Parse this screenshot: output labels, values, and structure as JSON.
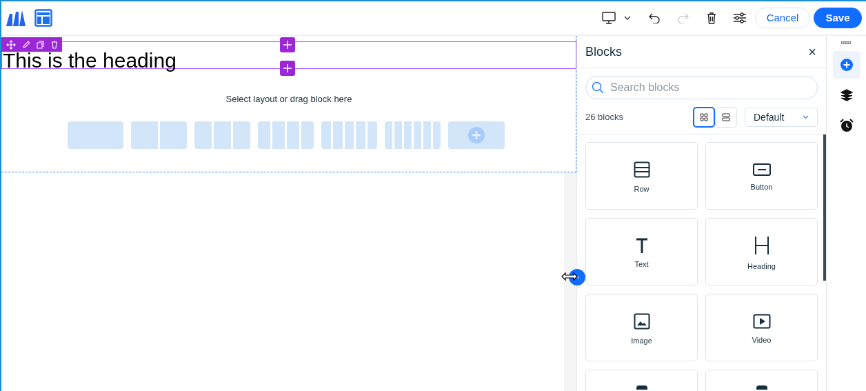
{
  "toolbar": {
    "cancel": "Cancel",
    "save": "Save",
    "redo_disabled": true
  },
  "canvas": {
    "heading": "This is the heading",
    "prompt": "Select layout or drag block here",
    "layouts": [
      {
        "kind": "cols-1"
      },
      {
        "kind": "cols-2"
      },
      {
        "kind": "cols-3"
      },
      {
        "kind": "cols-4"
      },
      {
        "kind": "cols-5"
      },
      {
        "kind": "cols-6"
      },
      {
        "kind": "add"
      }
    ]
  },
  "panel": {
    "title": "Blocks",
    "close": "×",
    "search": {
      "placeholder": "Search blocks"
    },
    "count": "26 blocks",
    "views": [
      {
        "kind": "grid",
        "selected": true
      },
      {
        "kind": "list",
        "selected": false
      }
    ],
    "sort": "Default",
    "blocks": [
      {
        "kind": "row",
        "label": "Row"
      },
      {
        "kind": "button",
        "label": "Button"
      },
      {
        "kind": "text",
        "label": "Text"
      },
      {
        "kind": "heading",
        "label": "Heading"
      },
      {
        "kind": "image",
        "label": "Image"
      },
      {
        "kind": "video",
        "label": "Video"
      },
      {
        "kind": "partial"
      },
      {
        "kind": "partial"
      }
    ]
  },
  "rail": [
    {
      "kind": "add",
      "selected": true
    },
    {
      "kind": "layers",
      "selected": false
    },
    {
      "kind": "alarm",
      "selected": false
    }
  ]
}
